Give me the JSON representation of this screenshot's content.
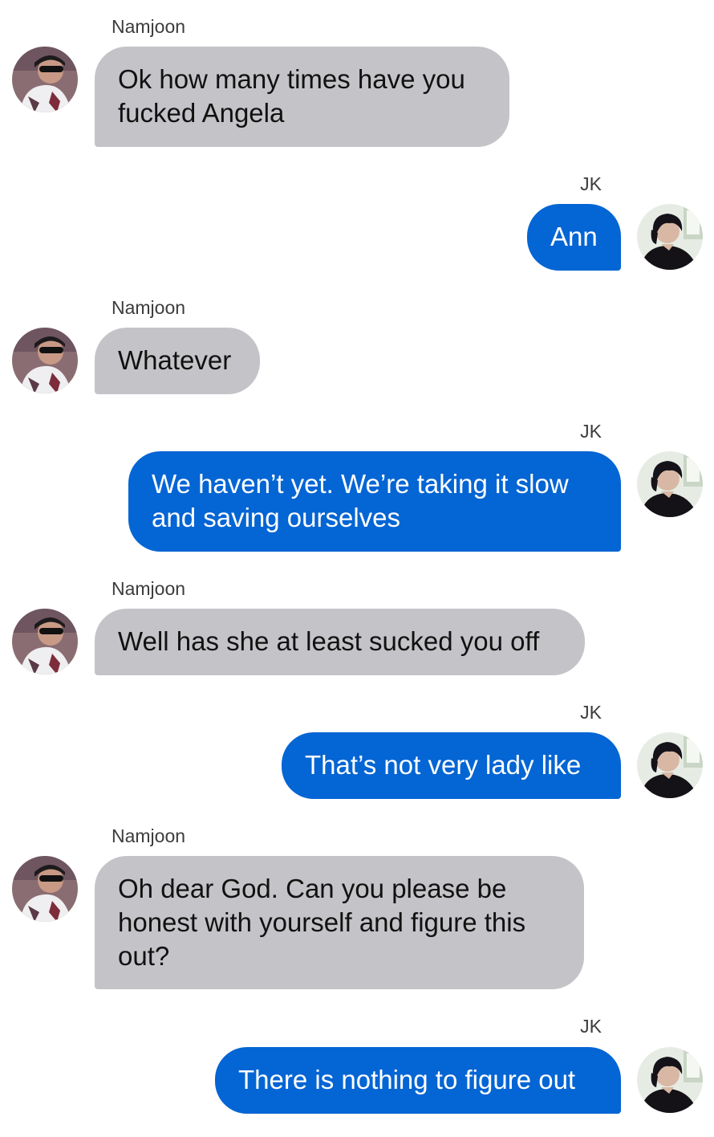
{
  "participants": {
    "left": {
      "name": "Namjoon",
      "avatar_icon": "namjoon-avatar-icon"
    },
    "right": {
      "name": "JK",
      "avatar_icon": "jk-avatar-icon"
    }
  },
  "colors": {
    "incoming_bubble": "#c4c4c8",
    "outgoing_bubble": "#0465d4",
    "outgoing_text": "#ffffff",
    "incoming_text": "#111111"
  },
  "messages": [
    {
      "side": "left",
      "sender": "Namjoon",
      "lines": [
        "Ok how many times have you",
        "fucked Angela"
      ]
    },
    {
      "side": "right",
      "sender": "JK",
      "lines": [
        "Ann"
      ]
    },
    {
      "side": "left",
      "sender": "Namjoon",
      "lines": [
        "Whatever"
      ]
    },
    {
      "side": "right",
      "sender": "JK",
      "lines": [
        "We haven’t yet. We’re taking it slow",
        "and saving ourselves"
      ]
    },
    {
      "side": "left",
      "sender": "Namjoon",
      "lines": [
        "Well has she at least sucked you off"
      ]
    },
    {
      "side": "right",
      "sender": "JK",
      "lines": [
        "That’s not very lady like"
      ]
    },
    {
      "side": "left",
      "sender": "Namjoon",
      "lines": [
        "Oh dear God. Can you please be",
        "honest with yourself and figure this",
        "out?"
      ]
    },
    {
      "side": "right",
      "sender": "JK",
      "lines": [
        "There is nothing to figure out"
      ]
    }
  ]
}
